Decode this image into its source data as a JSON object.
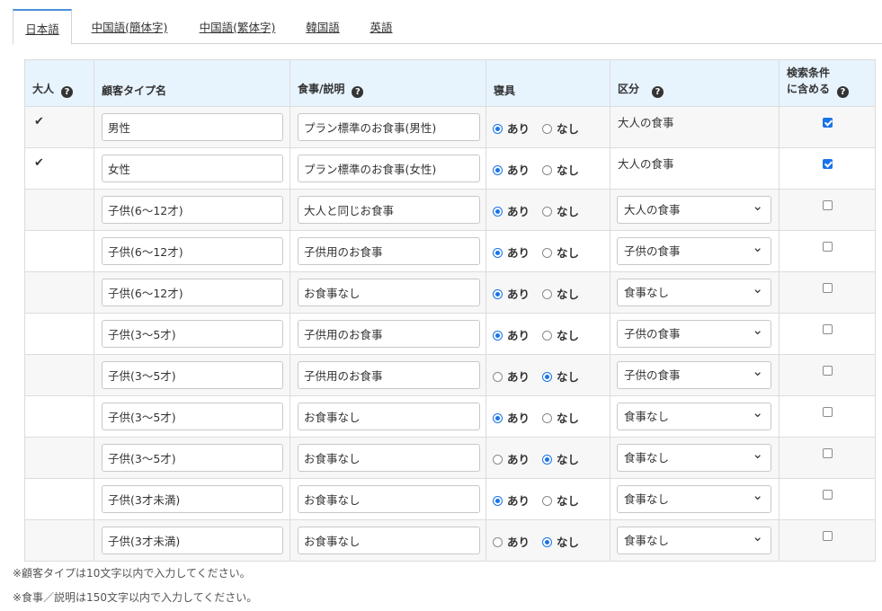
{
  "tabs": [
    {
      "label": "日本語",
      "active": true
    },
    {
      "label": "中国語(簡体字)",
      "active": false
    },
    {
      "label": "中国語(繁体字)",
      "active": false
    },
    {
      "label": "韓国語",
      "active": false
    },
    {
      "label": "英語",
      "active": false
    }
  ],
  "headers": {
    "adult": "大人",
    "customer_type": "顧客タイプ名",
    "meal": "食事/説明",
    "bedding": "寝具",
    "category": "区分",
    "search_line1": "検索条件",
    "search_line2": "に含める",
    "help_glyph": "?"
  },
  "radio_labels": {
    "yes": "あり",
    "no": "なし"
  },
  "rows": [
    {
      "adult": true,
      "name": "男性",
      "meal": "プラン標準のお食事(男性)",
      "bedding": "yes",
      "category": "大人の食事",
      "category_editable": false,
      "search": true
    },
    {
      "adult": true,
      "name": "女性",
      "meal": "プラン標準のお食事(女性)",
      "bedding": "yes",
      "category": "大人の食事",
      "category_editable": false,
      "search": true
    },
    {
      "adult": false,
      "name": "子供(6～12才)",
      "meal": "大人と同じお食事",
      "bedding": "yes",
      "category": "大人の食事",
      "category_editable": true,
      "search": false
    },
    {
      "adult": false,
      "name": "子供(6～12才)",
      "meal": "子供用のお食事",
      "bedding": "yes",
      "category": "子供の食事",
      "category_editable": true,
      "search": false
    },
    {
      "adult": false,
      "name": "子供(6～12才)",
      "meal": "お食事なし",
      "bedding": "yes",
      "category": "食事なし",
      "category_editable": true,
      "search": false
    },
    {
      "adult": false,
      "name": "子供(3～5才)",
      "meal": "子供用のお食事",
      "bedding": "yes",
      "category": "子供の食事",
      "category_editable": true,
      "search": false
    },
    {
      "adult": false,
      "name": "子供(3～5才)",
      "meal": "子供用のお食事",
      "bedding": "no",
      "category": "子供の食事",
      "category_editable": true,
      "search": false
    },
    {
      "adult": false,
      "name": "子供(3～5才)",
      "meal": "お食事なし",
      "bedding": "yes",
      "category": "食事なし",
      "category_editable": true,
      "search": false
    },
    {
      "adult": false,
      "name": "子供(3～5才)",
      "meal": "お食事なし",
      "bedding": "no",
      "category": "食事なし",
      "category_editable": true,
      "search": false
    },
    {
      "adult": false,
      "name": "子供(3才未満)",
      "meal": "お食事なし",
      "bedding": "yes",
      "category": "食事なし",
      "category_editable": true,
      "search": false
    },
    {
      "adult": false,
      "name": "子供(3才未満)",
      "meal": "お食事なし",
      "bedding": "no",
      "category": "食事なし",
      "category_editable": true,
      "search": false
    }
  ],
  "notes": [
    "※顧客タイプは10文字以内で入力してください。",
    "※食事／説明は150文字以内で入力してください。"
  ],
  "colors": {
    "accent": "#1a73e8",
    "header_bg": "#e7f3fd",
    "tab_active_border": "#4a90d9"
  },
  "icons": {
    "adult_check": "check-icon",
    "help": "question-circle-icon",
    "select_arrow": "chevron-down-icon"
  }
}
